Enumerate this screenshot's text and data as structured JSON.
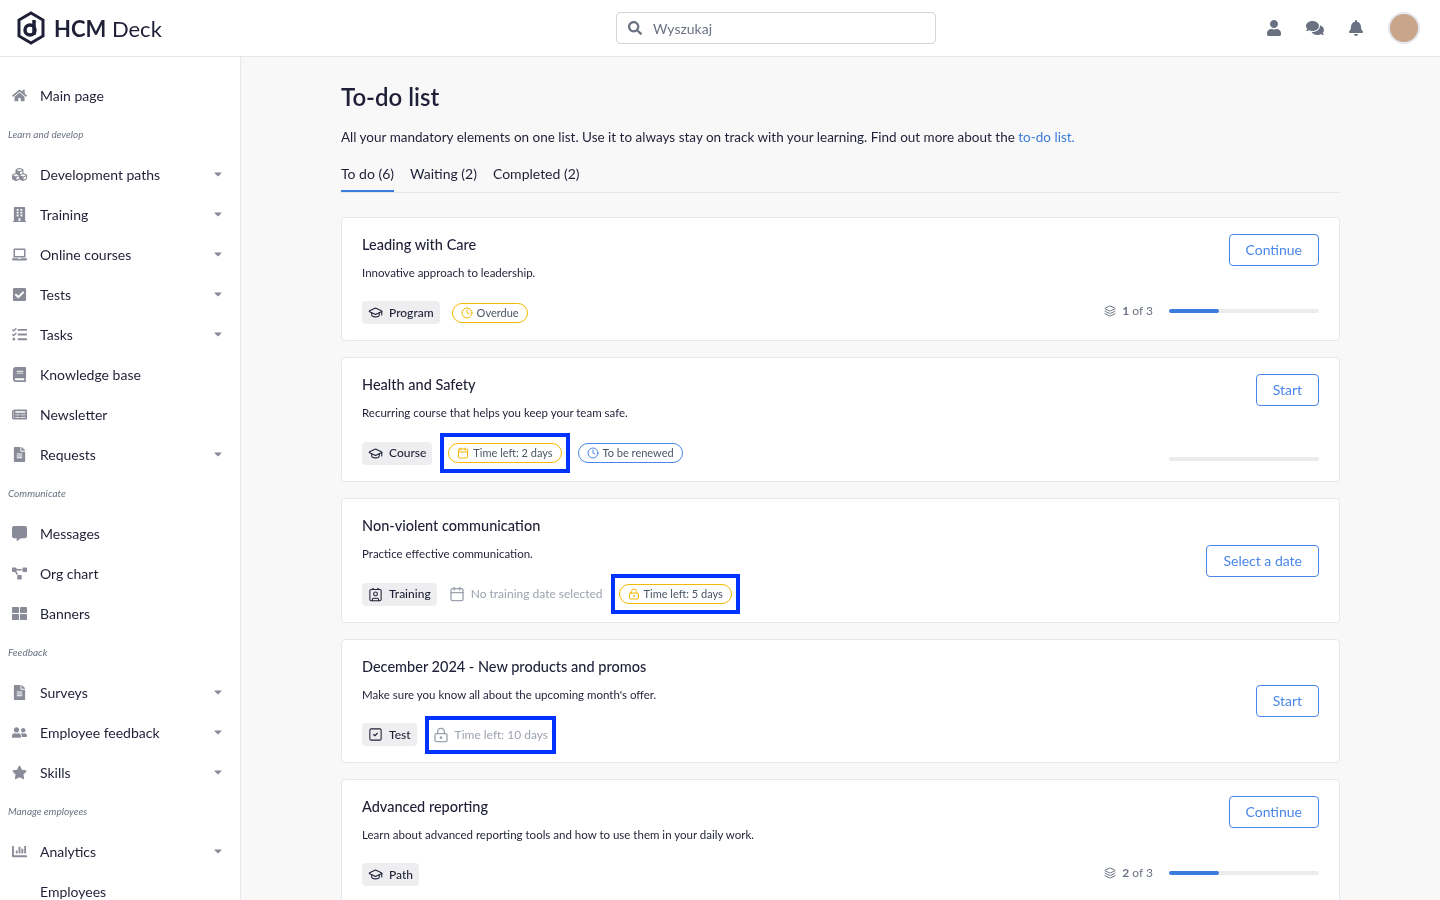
{
  "header": {
    "logo": "**HCM** Deck",
    "search": {
      "placeholder": "Wyszukaj"
    }
  },
  "sidebar": [
    {
      "kind": "item",
      "label": "Main page",
      "expandable": false
    },
    {
      "kind": "section",
      "label": "Learn and develop"
    },
    {
      "kind": "item",
      "label": "Development paths",
      "expandable": true
    },
    {
      "kind": "item",
      "label": "Training",
      "expandable": true
    },
    {
      "kind": "item",
      "label": "Online courses",
      "expandable": true
    },
    {
      "kind": "item",
      "label": "Tests",
      "expandable": true
    },
    {
      "kind": "item",
      "label": "Tasks",
      "expandable": true
    },
    {
      "kind": "item",
      "label": "Knowledge base",
      "expandable": false
    },
    {
      "kind": "item",
      "label": "Newsletter",
      "expandable": false
    },
    {
      "kind": "item",
      "label": "Requests",
      "expandable": true
    },
    {
      "kind": "section",
      "label": "Communicate"
    },
    {
      "kind": "item",
      "label": "Messages",
      "expandable": false
    },
    {
      "kind": "item",
      "label": "Org chart",
      "expandable": false
    },
    {
      "kind": "item",
      "label": "Banners",
      "expandable": false
    },
    {
      "kind": "section",
      "label": "Feedback"
    },
    {
      "kind": "item",
      "label": "Surveys",
      "expandable": true
    },
    {
      "kind": "item",
      "label": "Employee feedback",
      "expandable": true
    },
    {
      "kind": "item",
      "label": "Skills",
      "expandable": true
    },
    {
      "kind": "section",
      "label": "Manage employees"
    },
    {
      "kind": "item",
      "label": "Analytics",
      "expandable": true
    },
    {
      "kind": "subitem",
      "label": "Employees",
      "expandable": false
    }
  ],
  "page": {
    "title": "To-do list",
    "intro": "All your mandatory elements on one list. Use it to always stay on track with your learning. Find out more about the",
    "intro_link": "to-do list.",
    "tabs": [
      {
        "label": "To do (6)",
        "selected": true
      },
      {
        "label": "Waiting (2)",
        "selected": false
      },
      {
        "label": "Completed (2)",
        "selected": false
      }
    ],
    "cards": [
      {
        "title": "Leading with Care",
        "description": "Innovative approach to leadership.",
        "tag": {
          "kind": "cap",
          "label": "Program"
        },
        "badges": [
          {
            "kind": "overdue",
            "text": "Overdue",
            "color": "#f5b800",
            "highlighted": false
          }
        ],
        "button": "Continue",
        "progress": {
          "level": 0.33,
          "text": "**1** of 3"
        }
      },
      {
        "title": "Health and Safety",
        "description": "Recurring course that helps you keep your team safe.",
        "tag": {
          "kind": "cap",
          "label": "Course"
        },
        "badges": [
          {
            "kind": "deadline",
            "text": "Time left: 2 days",
            "color": "#f5b800",
            "highlighted": true
          },
          {
            "kind": "renewal",
            "text": "To be renewed",
            "color": "#4a86e8",
            "highlighted": false
          }
        ],
        "button": "Start",
        "progress": {
          "level": 0
        }
      },
      {
        "title": "Non-violent communication",
        "description": "Practice effective communication.",
        "tag": {
          "kind": "badge",
          "label": "Training"
        },
        "badges": [
          {
            "kind": "unscheduled",
            "text": "No training date selected",
            "color": "#9ca3af",
            "highlighted": false
          },
          {
            "kind": "locked",
            "text": "Time left: 5 days",
            "color": "#f5b800",
            "highlighted": true
          }
        ],
        "button": "Select a date"
      },
      {
        "title": "December 2024 - New products and promos",
        "description": "Make sure you know all about the upcoming month's offer.",
        "tag": {
          "kind": "check",
          "label": "Test"
        },
        "badges": [
          {
            "kind": "pending",
            "text": "Time left: 10 days",
            "color": "#9ca3af",
            "highlighted": true
          }
        ],
        "button": "Start"
      },
      {
        "title": "Advanced reporting",
        "description": "Learn about advanced reporting tools and how to use them in your daily work.",
        "tag": {
          "kind": "cap",
          "label": "Path"
        },
        "button": "Continue",
        "progress": {
          "level": 0.33,
          "text": "**2** of 3"
        }
      }
    ]
  }
}
